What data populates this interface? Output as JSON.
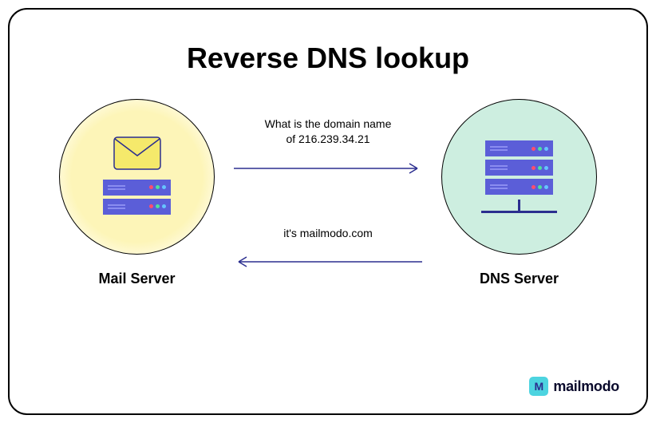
{
  "title": "Reverse DNS lookup",
  "left_node": {
    "label": "Mail Server"
  },
  "right_node": {
    "label": "DNS Server"
  },
  "query": {
    "line1": "What is the domain name",
    "line2": "of 216.239.34.21"
  },
  "response": {
    "text": "it's mailmodo.com"
  },
  "brand": {
    "mark": "M",
    "name": "mailmodo"
  },
  "colors": {
    "arrow": "#2b2e8f",
    "circle_left_bg": "#fdf5b8",
    "circle_right_bg": "#cdeee0",
    "server": "#5b5ed8"
  }
}
